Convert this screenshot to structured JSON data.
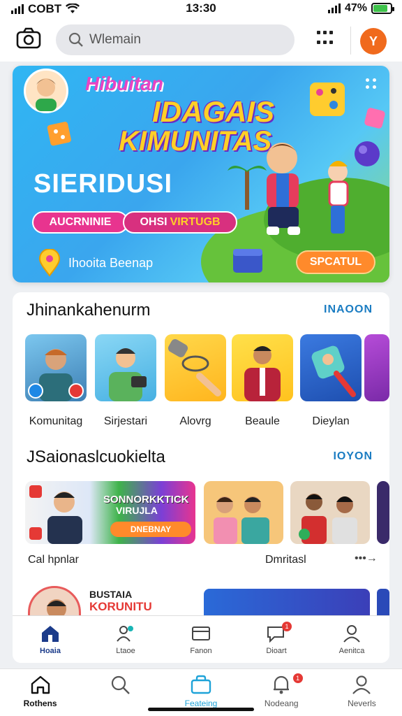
{
  "status_bar": {
    "carrier": "COBT",
    "time": "13:30",
    "battery": "47%",
    "battery_level": 0.85
  },
  "search": {
    "placeholder": "Wlemain"
  },
  "header": {
    "avatar_letter": "Y",
    "accent": "#f06a1d"
  },
  "banner": {
    "subtitle": "Hibuitan",
    "title_line1": "IDAGAIS",
    "title_line2": "KIMUNITAS",
    "tagline": "SIERIDUSI",
    "pill1": "AUCRNINIE",
    "pill2_a": "OHSI",
    "pill2_b": "VIRTUGB",
    "location": "Ihooita Beenap",
    "cta": "SPCATUL"
  },
  "section1": {
    "title": "Jhinankahenurm",
    "link": "INAOON",
    "items": [
      {
        "label": "Komunitag",
        "icon": "community-icon"
      },
      {
        "label": "Sirjestari",
        "icon": "tablet-icon"
      },
      {
        "label": "Alovrg",
        "icon": "microphone-icon"
      },
      {
        "label": "Beaule",
        "icon": "presenter-icon"
      },
      {
        "label": "Dieylan",
        "icon": "game-icon"
      }
    ]
  },
  "section2": {
    "title": "JSaionaslcuokielta",
    "link": "IOYON",
    "feature_title": "SONNORKKTICK",
    "feature_title2": "VIRUJLA",
    "feature_button": "DNEBNAY",
    "label_left": "Cal hpnlar",
    "label_right": "Dmritasl",
    "more_arrow": "•••→"
  },
  "bottom_row": {
    "text1": "BUSTAIA",
    "text2": "KORUNITU"
  },
  "inner_tabs": [
    {
      "label": "Hoaia",
      "icon": "home-icon",
      "active": true
    },
    {
      "label": "Ltaoe",
      "icon": "people-icon",
      "active": false
    },
    {
      "label": "Fanon",
      "icon": "card-icon",
      "active": false
    },
    {
      "label": "Dioart",
      "icon": "chat-icon",
      "active": false,
      "badge": "1"
    },
    {
      "label": "Aenitca",
      "icon": "person-icon",
      "active": false
    }
  ],
  "bottom_nav": [
    {
      "label": "Rothens",
      "icon": "home-icon"
    },
    {
      "label": "",
      "icon": "search-icon"
    },
    {
      "label": "Feateing",
      "icon": "bag-icon"
    },
    {
      "label": "Nodeang",
      "icon": "notification-icon",
      "badge": "1"
    },
    {
      "label": "Neverls",
      "icon": "profile-icon"
    }
  ]
}
